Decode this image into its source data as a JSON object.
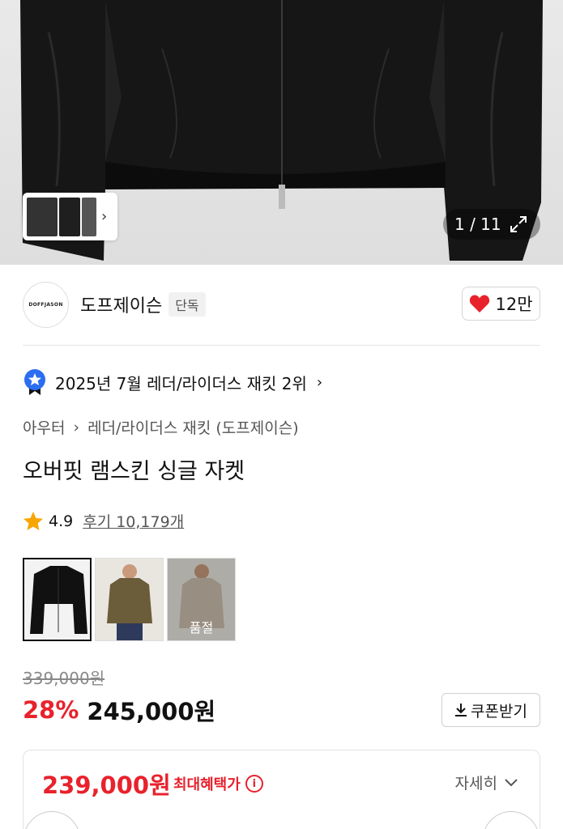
{
  "gallery": {
    "counter": "1 / 11"
  },
  "brand": {
    "logo_text": "DOFFJASON",
    "name": "도프제이슨",
    "badge": "단독",
    "likes": "12만"
  },
  "ranking": {
    "text": "2025년 7월 레더/라이더스 재킷 2위"
  },
  "breadcrumb": {
    "category": "아우터",
    "sub": "레더/라이더스 재킷 (도프제이슨)"
  },
  "product": {
    "title": "오버핏 램스킨 싱글 자켓",
    "rating": "4.9",
    "reviews": "후기 10,179개",
    "options": [
      {
        "color": "#111111",
        "soldout": ""
      },
      {
        "color": "#6b5c3a",
        "soldout": ""
      },
      {
        "color": "#cbbfae",
        "soldout": "품절"
      }
    ]
  },
  "price": {
    "original": "339,000원",
    "discount": "28%",
    "current": "245,000원",
    "coupon_label": "쿠폰받기"
  },
  "benefit": {
    "price": "239,000원",
    "label": "최대혜택가",
    "detail": "자세히"
  },
  "colors": {
    "accent": "#e8222c",
    "star": "#f7a600"
  }
}
